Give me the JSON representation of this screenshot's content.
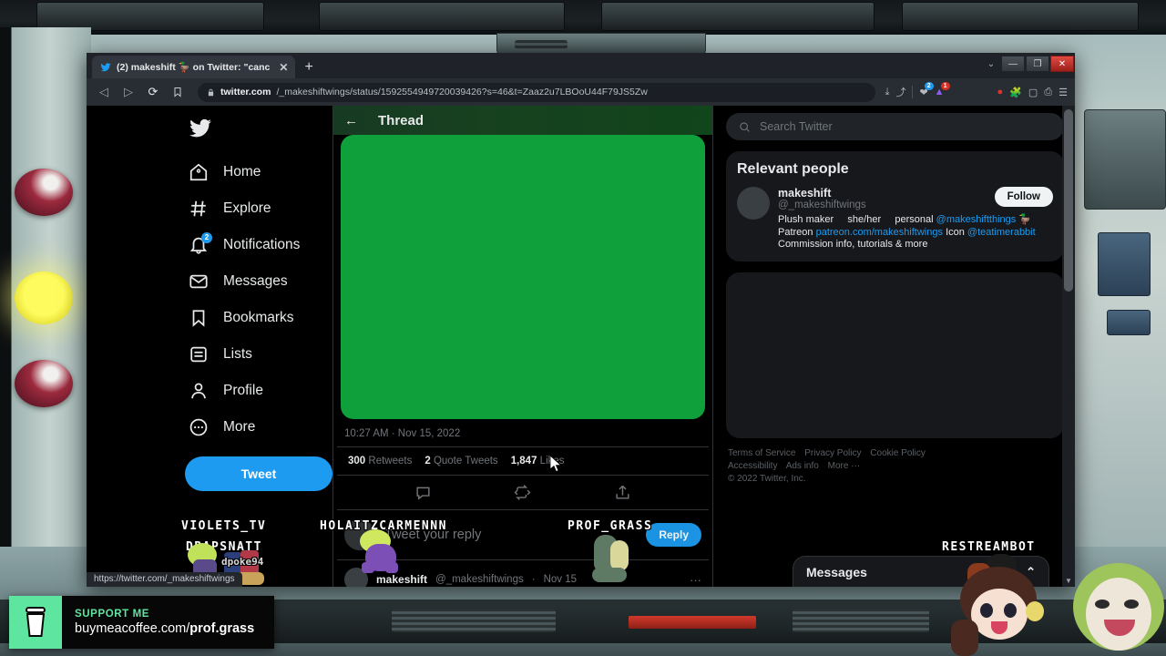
{
  "browser": {
    "tab": {
      "title": "(2) makeshift 🦆 on Twitter: \"canc",
      "close_label": "✕",
      "favicon": "twitter-bird-icon"
    },
    "new_tab_label": "+",
    "window_controls": {
      "minimize": "—",
      "maximize": "❐",
      "close": "✕",
      "chevron": "⌄"
    },
    "nav": {
      "back": "◁",
      "forward": "▷",
      "reload": "⟳",
      "bookmark_icon": "bookmark-icon"
    },
    "omnibox": {
      "lock_icon": "lock-icon",
      "host": "twitter.com",
      "path": "/_makeshiftwings/status/1592554949720039426?s=46&t=Zaaz2u7LBOoU44F79JS5Zw"
    },
    "toolbar_icons": [
      "download-icon",
      "share-icon",
      "extension-pocket-icon",
      "extension-alert-icon",
      "record-icon",
      "puzzle-icon",
      "sidebar-icon",
      "cast-icon",
      "menu-icon"
    ],
    "badges": {
      "pocket": "2",
      "alert": "1"
    },
    "statusbar_url": "https://twitter.com/_makeshiftwings"
  },
  "sidebar": {
    "logo": "twitter-bird-icon",
    "items": [
      {
        "label": "Home",
        "icon": "home-icon"
      },
      {
        "label": "Explore",
        "icon": "hash-icon"
      },
      {
        "label": "Notifications",
        "icon": "bell-icon",
        "badge": "2"
      },
      {
        "label": "Messages",
        "icon": "envelope-icon"
      },
      {
        "label": "Bookmarks",
        "icon": "bookmark-icon"
      },
      {
        "label": "Lists",
        "icon": "list-icon"
      },
      {
        "label": "Profile",
        "icon": "person-icon"
      },
      {
        "label": "More",
        "icon": "more-circle-icon"
      }
    ],
    "tweet_button": "Tweet"
  },
  "thread": {
    "header_title": "Thread",
    "back_icon": "back-arrow-icon",
    "media": {
      "type": "image",
      "color": "#0fa03c",
      "alt": "green-screen-image"
    },
    "timestamp": "10:27 AM · Nov 15, 2022",
    "stats": [
      {
        "count": "300",
        "label": "Retweets"
      },
      {
        "count": "2",
        "label": "Quote Tweets"
      },
      {
        "count": "1,847",
        "label": "Likes"
      }
    ],
    "actions": [
      "reply-icon",
      "retweet-icon",
      "share-icon"
    ],
    "reply_placeholder": "Tweet your reply",
    "reply_button": "Reply",
    "reply_tweet": {
      "name": "makeshift",
      "handle": "@_makeshiftwings",
      "separator": "·",
      "date": "Nov 15",
      "more": "···"
    }
  },
  "right_panel": {
    "search_placeholder": "Search Twitter",
    "search_icon": "search-icon",
    "relevant_people": {
      "title": "Relevant people",
      "person": {
        "name": "makeshift",
        "handle": "@_makeshiftwings",
        "follow_label": "Follow",
        "bio_line1_a": "Plush maker",
        "bio_line1_b": "she/her",
        "bio_line1_c": "personal",
        "bio_link1": "@makeshiftthings",
        "bio_emoji": "🦆",
        "bio_text2": "Patreon",
        "bio_link2": "patreon.com/makeshiftwings",
        "bio_text3": "Icon",
        "bio_link3": "@teatimerabbit",
        "bio_text4": "Commission info,",
        "bio_text5": "tutorials & more"
      }
    },
    "footer_links_row1": [
      "Terms of Service",
      "Privacy Policy",
      "Cookie Policy"
    ],
    "footer_links_row2": [
      "Accessibility",
      "Ads info",
      "More ···"
    ],
    "copyright": "© 2022 Twitter, Inc.",
    "dm_dock": {
      "title": "Messages",
      "compose_icon": "new-message-icon",
      "expand_icon": "chevron-up-icon"
    }
  },
  "stream_overlay": {
    "usernames": [
      "VIOLETS_TV",
      "DRAPSNATT",
      "HOLAITZCARMENNN",
      "PROF_GRASS",
      "RESTREAMBOT"
    ],
    "chat_handle": "dpoke94",
    "support_banner": {
      "heading": "SUPPORT ME",
      "url_prefix": "buymeacoffee.com/",
      "url_name": "prof.grass",
      "icon": "coffee-cup-icon",
      "accent": "#5ee6a0"
    }
  },
  "colors": {
    "twitter_blue": "#1d9bf0",
    "green_screen": "#0fa03c",
    "page_bg": "#000000",
    "card_bg": "#16181c"
  }
}
